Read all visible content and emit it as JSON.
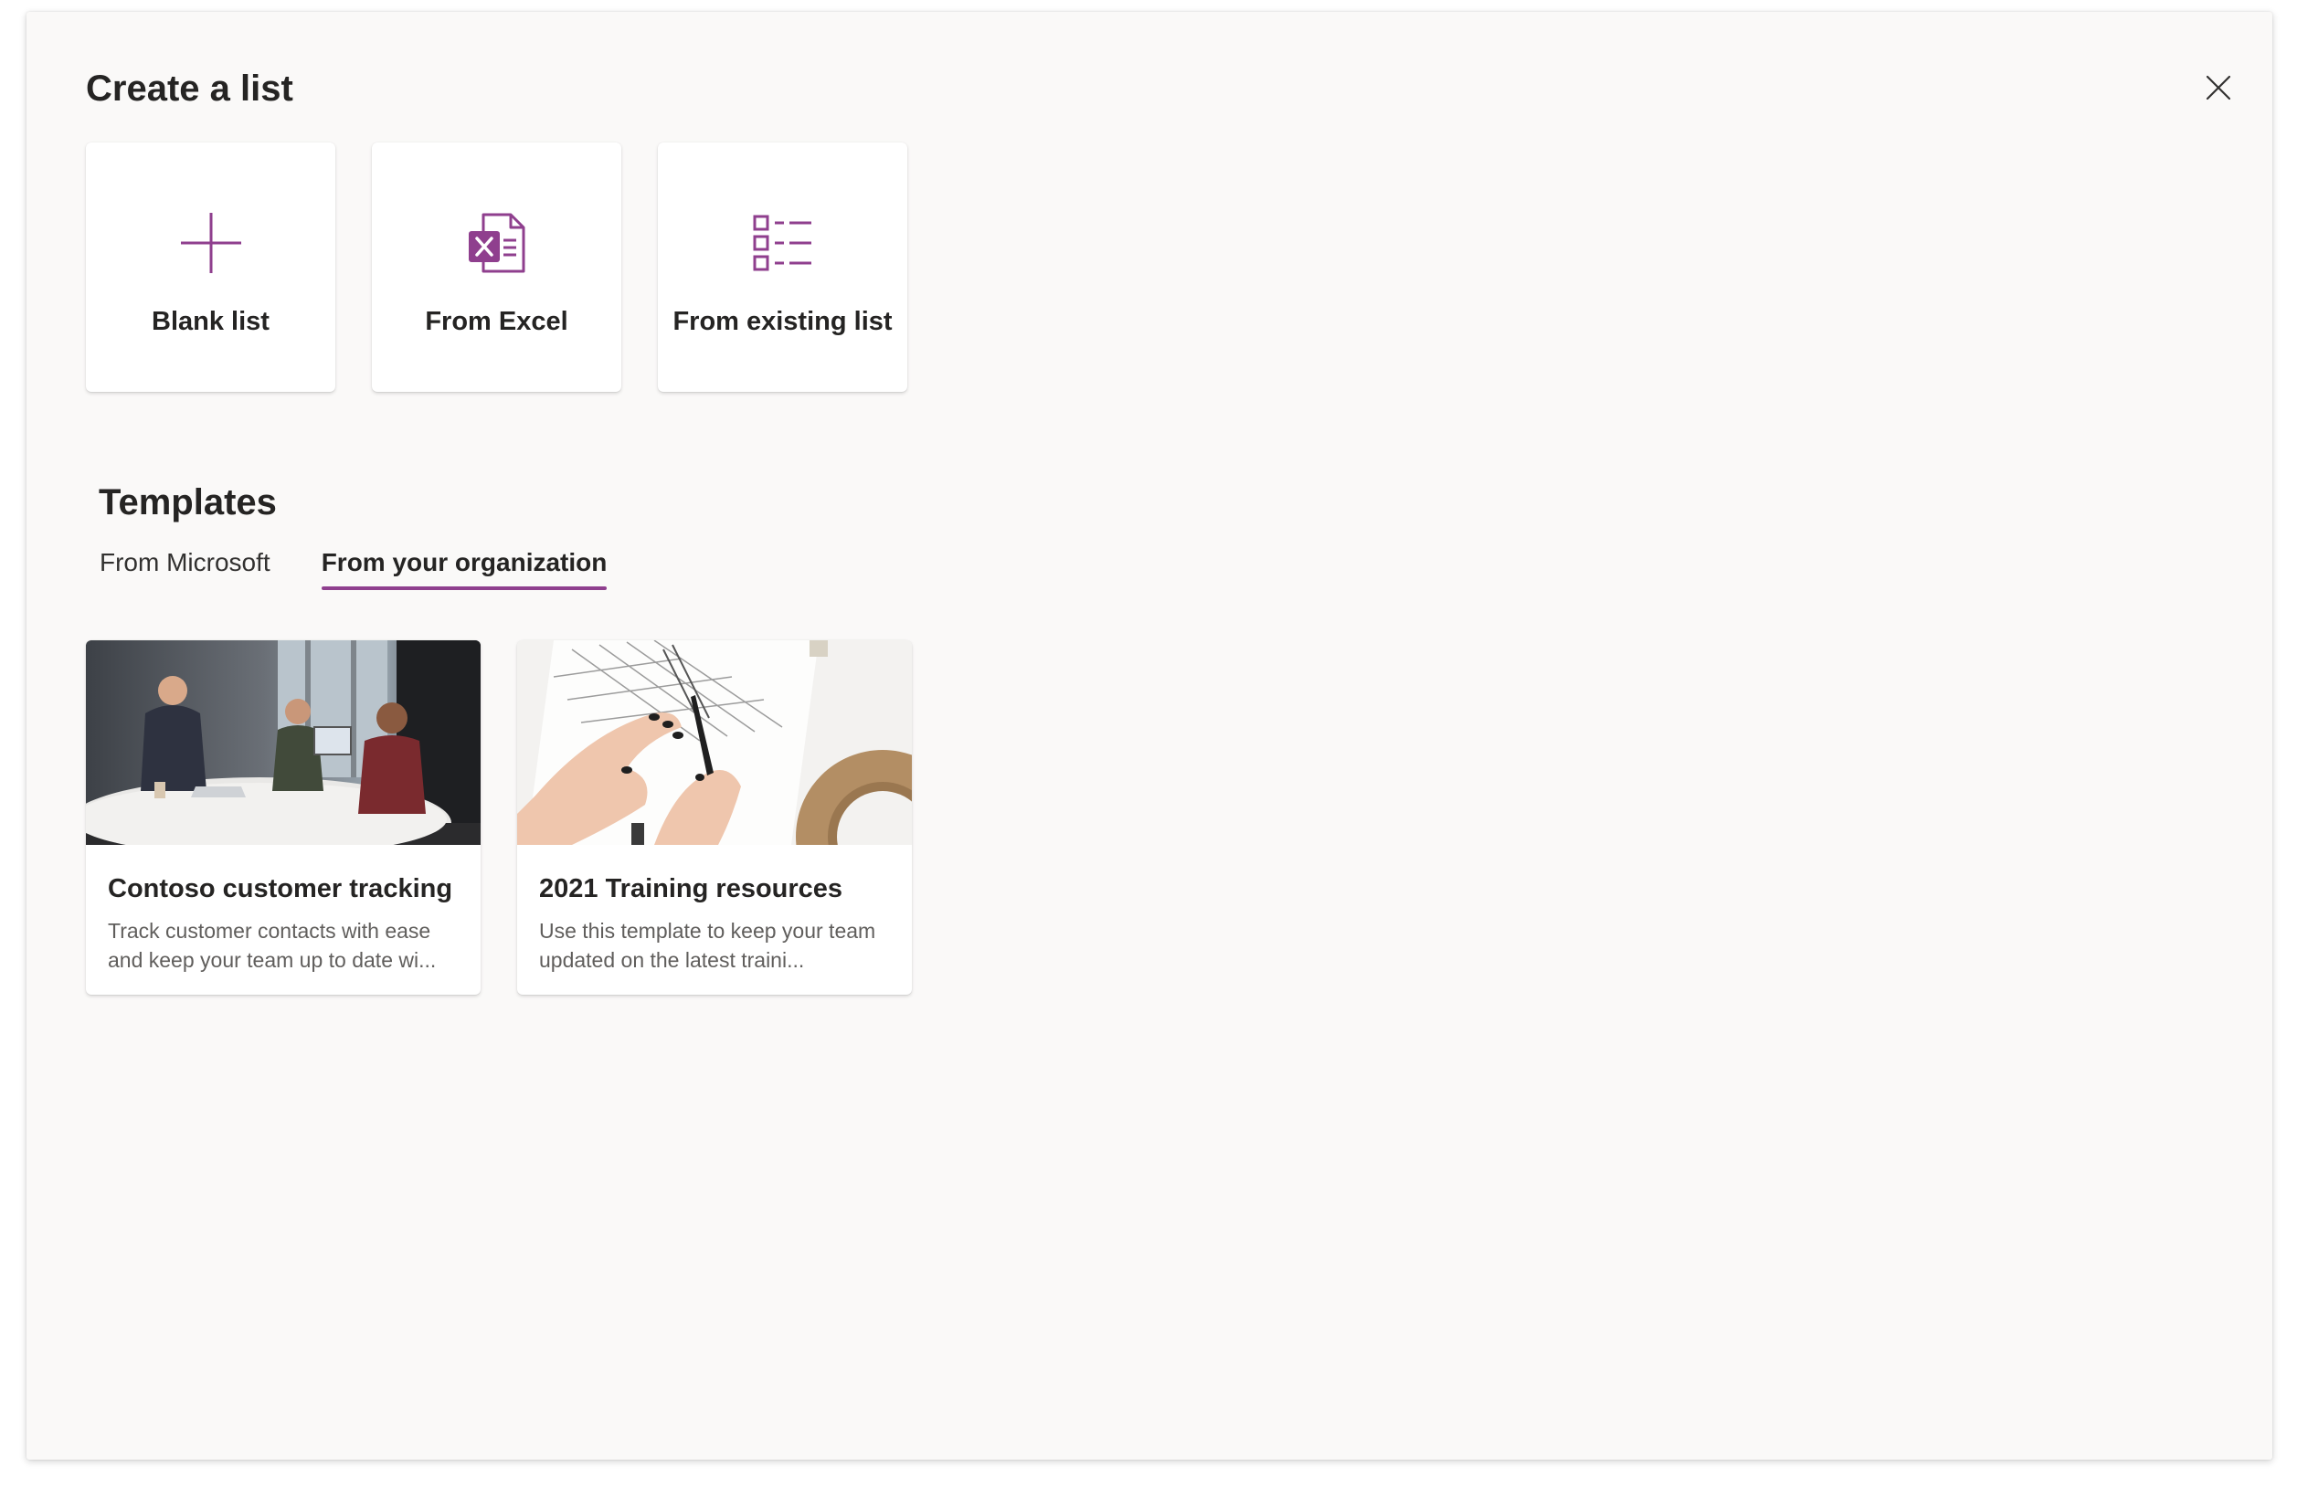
{
  "dialog": {
    "title": "Create a list",
    "close_icon": "close-icon"
  },
  "create_options": [
    {
      "label": "Blank list",
      "icon": "plus-icon"
    },
    {
      "label": "From Excel",
      "icon": "excel-icon"
    },
    {
      "label": "From existing list",
      "icon": "list-icon"
    }
  ],
  "templates": {
    "heading": "Templates",
    "tabs": [
      {
        "label": "From Microsoft",
        "active": false
      },
      {
        "label": "From your organization",
        "active": true
      }
    ],
    "cards": [
      {
        "title": "Contoso customer tracking",
        "description": "Track customer contacts with ease and keep your team up to date wi...",
        "image": "office-meeting-photo"
      },
      {
        "title": "2021 Training resources",
        "description": "Use this template to keep your team updated on the latest traini...",
        "image": "hands-calendar-photo"
      }
    ]
  },
  "colors": {
    "accent": "#8f3f8e",
    "dialog_bg": "#faf9f8",
    "card_bg": "#ffffff"
  }
}
